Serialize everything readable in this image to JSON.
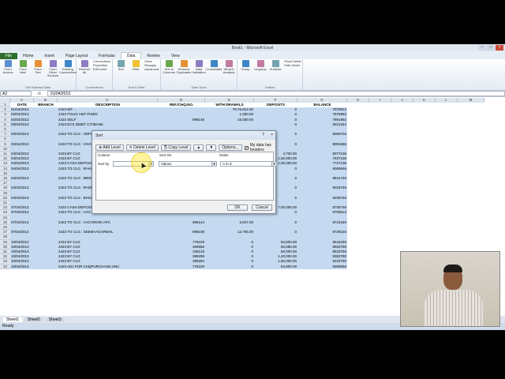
{
  "window": {
    "title": "Book1 - Microsoft Excel"
  },
  "tabs": [
    "File",
    "Home",
    "Insert",
    "Page Layout",
    "Formulas",
    "Data",
    "Review",
    "View"
  ],
  "active_tab": "Data",
  "ribbon": {
    "groups": [
      {
        "label": "Get External Data",
        "buttons": [
          "From Access",
          "From Web",
          "From Text",
          "From Other Sources",
          "Existing Connections"
        ]
      },
      {
        "label": "Connections",
        "buttons": [
          "Refresh All"
        ],
        "small": [
          "Connections",
          "Properties",
          "Edit Links"
        ]
      },
      {
        "label": "Sort & Filter",
        "buttons": [
          "Sort",
          "Filter"
        ],
        "small": [
          "Clear",
          "Reapply",
          "Advanced"
        ]
      },
      {
        "label": "Data Tools",
        "buttons": [
          "Text to Columns",
          "Remove Duplicates",
          "Data Validation",
          "Consolidate",
          "What-If Analysis"
        ]
      },
      {
        "label": "Outline",
        "buttons": [
          "Group",
          "Ungroup",
          "Subtotal"
        ],
        "small": [
          "Show Detail",
          "Hide Detail"
        ]
      }
    ]
  },
  "formula_bar": {
    "name_box": "A2",
    "fx": "fx",
    "value": "01/04/2013"
  },
  "columns": [
    "A",
    "B",
    "C",
    "D",
    "E",
    "F",
    "G",
    "H",
    "I",
    "J",
    "K",
    "L",
    "M"
  ],
  "header_row": [
    "DATE",
    "BRANCH",
    "DESCRIPTION",
    "REF./CHQ.NO.",
    "WITH DRAWALS",
    "DEPOSITS",
    "BALANCE"
  ],
  "rows": [
    {
      "n": "2",
      "c": [
        "01/04/2013",
        "",
        "2423 B/F ...",
        "",
        "79,75,912.00",
        "0",
        "7975912"
      ]
    },
    {
      "n": "3",
      "c": [
        "02/04/2013",
        "",
        "2423 FOLIO AMT FIXED",
        "",
        "1,050.00",
        "0",
        "7976962"
      ]
    },
    {
      "n": "4",
      "c": [
        "02/04/2013",
        "",
        "2423 SELF",
        "996146",
        "15,000.00",
        "0",
        "7991962"
      ]
    },
    {
      "n": "5",
      "c": [
        "03/04/2013",
        "",
        "2423 ECS DEBIT CITIBANK",
        "",
        "",
        "0",
        "8021342"
      ]
    },
    {
      "n": "6",
      "c": [
        "",
        "",
        "",
        "",
        "",
        "",
        ""
      ]
    },
    {
      "n": "7",
      "c": [
        "03/04/2013",
        "",
        "2423 TO CLG : HDFC",
        "",
        "",
        "0",
        "8056702"
      ]
    },
    {
      "n": "8",
      "c": [
        "",
        "",
        "",
        "",
        "",
        "",
        ""
      ]
    },
    {
      "n": "9",
      "c": [
        "03/04/2013",
        "",
        "2423 TO CLG : VIVAC",
        "",
        "",
        "0",
        "8081866"
      ]
    },
    {
      "n": "10",
      "c": [
        "",
        "",
        "",
        "",
        "",
        "",
        ""
      ]
    },
    {
      "n": "11",
      "c": [
        "04/04/2013",
        "",
        "2423 BY CLG",
        "",
        "",
        "4,730.00",
        "8077136"
      ]
    },
    {
      "n": "12",
      "c": [
        "04/04/2013",
        "",
        "2423 BY CLG",
        "",
        "",
        "1,50,000.00",
        "7927136"
      ]
    },
    {
      "n": "13",
      "c": [
        "04/04/2013",
        "",
        "2423 CASH DEPOSIT",
        "",
        "",
        "2,00,000.00",
        "7727136"
      ]
    },
    {
      "n": "14",
      "c": [
        "04/04/2013",
        "",
        "2423 TO CLG : RAKHE",
        "",
        "",
        "0",
        "8090646"
      ]
    },
    {
      "n": "15",
      "c": [
        "",
        "",
        "",
        "",
        "",
        "",
        ""
      ]
    },
    {
      "n": "16",
      "c": [
        "04/04/2013",
        "",
        "2423 TO CLG : MEENA",
        "",
        "",
        "0",
        "8541746"
      ]
    },
    {
      "n": "17",
      "c": [
        "",
        "",
        "",
        "",
        "",
        "",
        ""
      ]
    },
    {
      "n": "18",
      "c": [
        "04/04/2013",
        "",
        "2423 TO CLG : RADHIKAJEWELLE",
        "",
        "",
        "0",
        "9018746"
      ]
    },
    {
      "n": "19",
      "c": [
        "",
        "",
        "",
        "",
        "",
        "",
        ""
      ]
    },
    {
      "n": "20",
      "c": [
        "04/04/2013",
        "",
        "2423 TO CLG : BHAWANIJEWELLE",
        "996149",
        "3,87,000.00",
        "0",
        "9405746"
      ]
    },
    {
      "n": "21",
      "c": [
        "",
        "",
        "",
        "",
        "",
        "",
        ""
      ]
    },
    {
      "n": "22",
      "c": [
        "07/04/2013",
        "",
        "2423 CASH DEPOSIT",
        "",
        "",
        "7,00,000.00",
        "8705746"
      ]
    },
    {
      "n": "23",
      "c": [
        "07/04/2013",
        "",
        "2423 TO CLG : AAO EROIII APC",
        "996145",
        "3,767.00",
        "0",
        "8709513"
      ]
    },
    {
      "n": "24",
      "c": [
        "",
        "",
        "",
        "",
        "",
        "",
        ""
      ]
    },
    {
      "n": "25",
      "c": [
        "07/04/2013",
        "",
        "2423 TO CLG : AAO EROIII APC",
        "996144",
        "6,927.00",
        "0",
        "8716440"
      ]
    },
    {
      "n": "26",
      "c": [
        "",
        "",
        "",
        "",
        "",
        "",
        ""
      ]
    },
    {
      "n": "27",
      "c": [
        "07/04/2013",
        "",
        "2423 TO CLG : SEEMAAGARWAL",
        "996106",
        "12,705.00",
        "0",
        "8729145"
      ]
    },
    {
      "n": "28",
      "c": [
        "",
        "",
        "",
        "",
        "",
        "",
        ""
      ]
    },
    {
      "n": "29",
      "c": [
        "10/04/2013",
        "",
        "2423 BY CLG",
        "776229",
        "0",
        "84,800.00",
        "8644345"
      ]
    },
    {
      "n": "30",
      "c": [
        "10/04/2013",
        "",
        "2423 BY CLG",
        "469565",
        "0",
        "60,585.00",
        "8583750"
      ]
    },
    {
      "n": "31",
      "c": [
        "10/04/2013",
        "",
        "2423 BY CLG",
        "108129",
        "0",
        "60,000.00",
        "8523750"
      ]
    },
    {
      "n": "32",
      "c": [
        "10/04/2013",
        "",
        "2423 BY CLG",
        "388289",
        "0",
        "1,40,000.00",
        "8383750"
      ]
    },
    {
      "n": "33",
      "c": [
        "10/04/2013",
        "",
        "2423 BY CLG",
        "388284",
        "0",
        "1,60,000.00",
        "8223750"
      ]
    },
    {
      "n": "34",
      "c": [
        "10/04/2013",
        "",
        "2423 ADJ FOR CHQPURCHASE:UNC",
        "776229",
        "0",
        "84,800.00",
        "8308550"
      ]
    }
  ],
  "sheets": [
    "Sheet1",
    "Sheet2",
    "Sheet3"
  ],
  "status": "Ready",
  "dialog": {
    "title": "Sort",
    "help": "?",
    "close": "×",
    "buttons": {
      "add": "Add Level",
      "delete": "Delete Level",
      "copy": "Copy Level",
      "options": "Options..."
    },
    "headers_label": "My data has headers",
    "headers_checked": true,
    "col_header": "Column",
    "sorton_header": "Sort On",
    "order_header": "Order",
    "sortby_label": "Sort by",
    "sortby_value": "",
    "sorton_value": "Values",
    "order_value": "A to Z",
    "ok": "OK",
    "cancel": "Cancel"
  }
}
